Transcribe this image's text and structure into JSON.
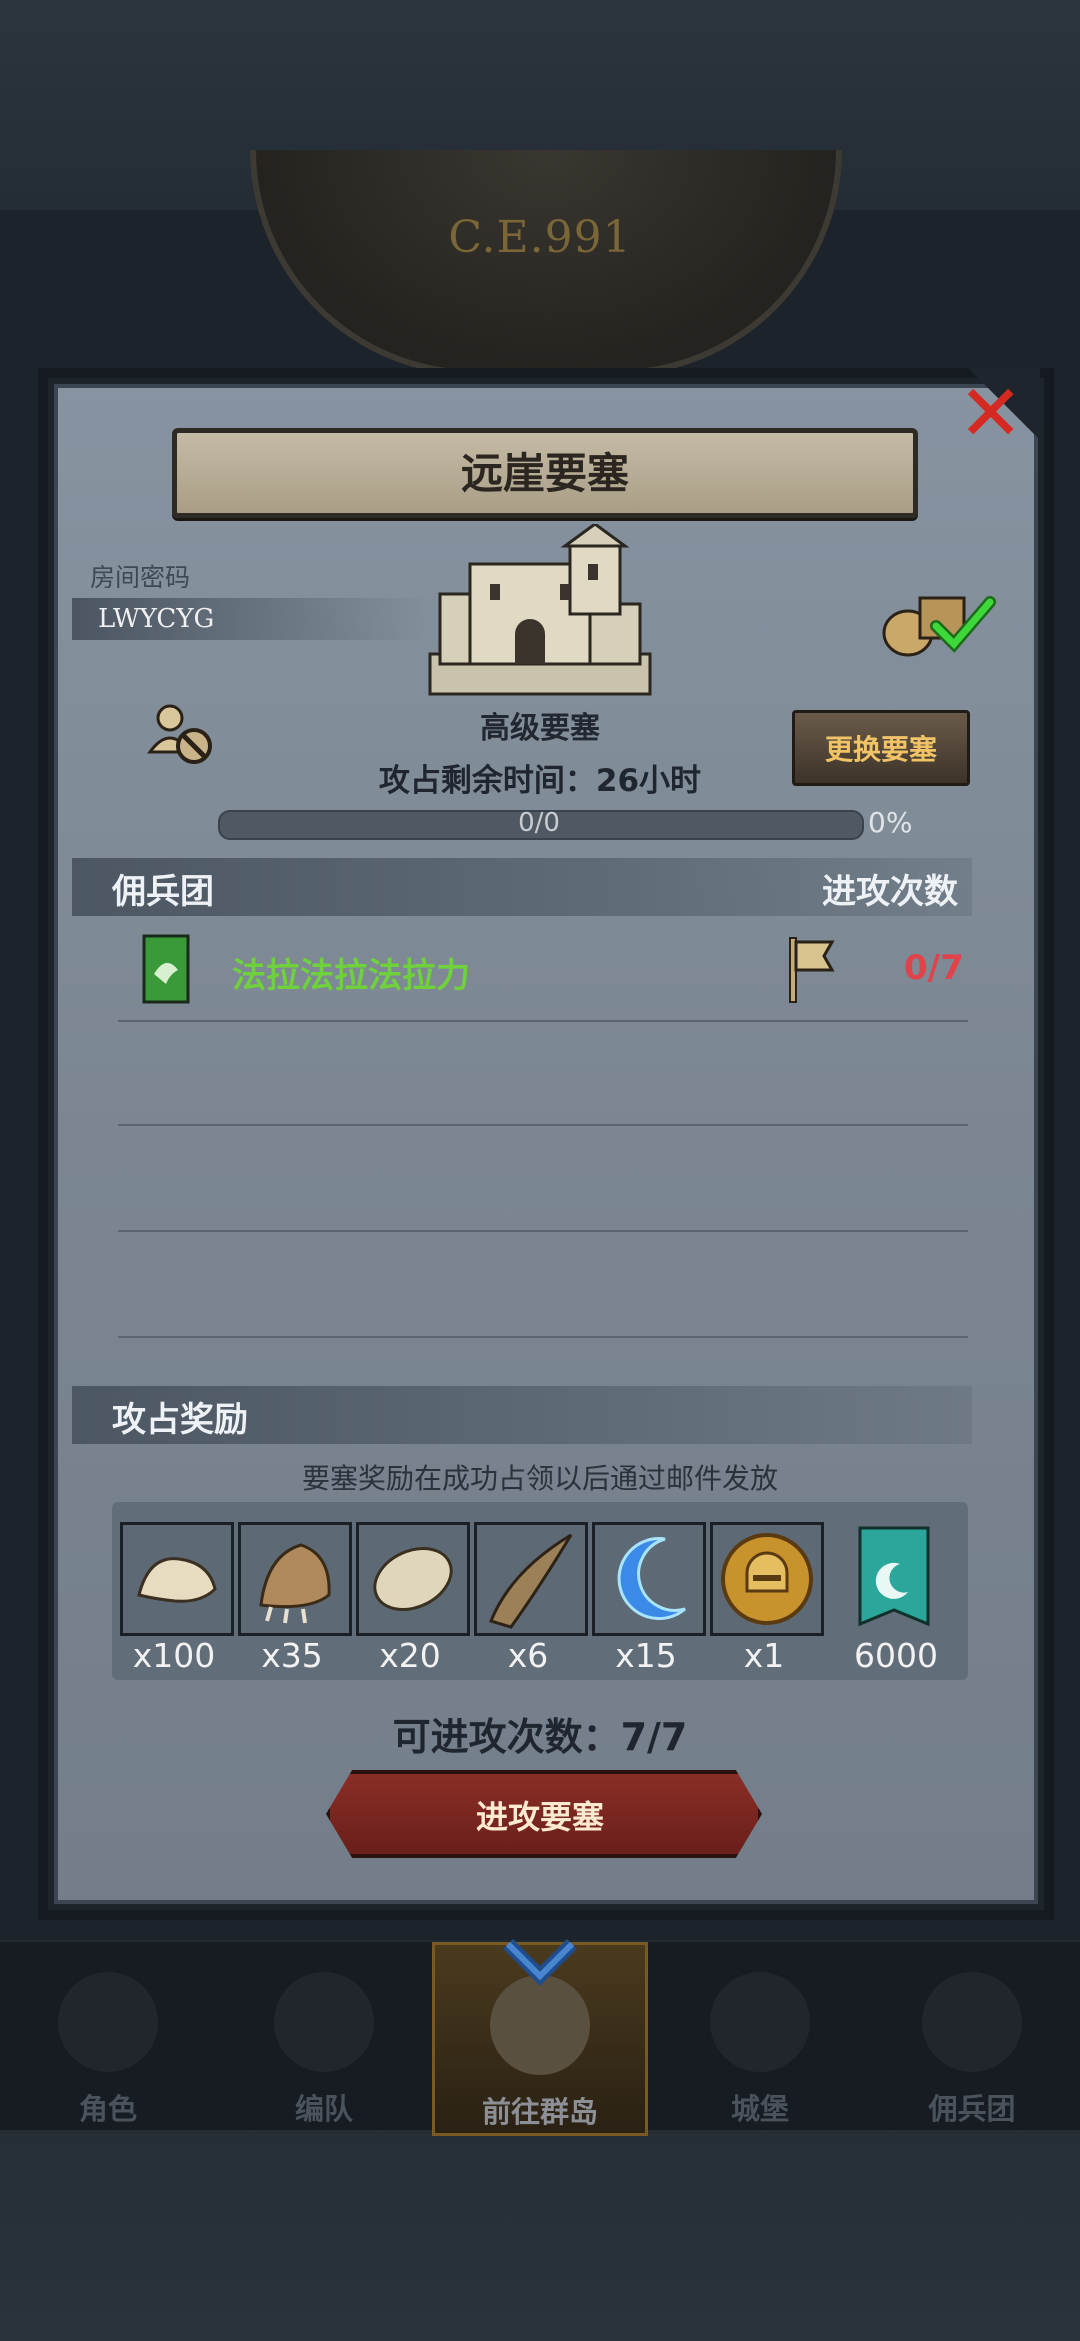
{
  "era": "C.E.991",
  "dialog": {
    "title": "远崖要塞",
    "room_password_label": "房间密码",
    "room_password": "LWYCYG",
    "fortress_level": "高级要塞",
    "time_left": "攻占剩余时间：26小时",
    "change_button": "更换要塞",
    "progress": {
      "text": "0/0",
      "percent_text": "0%",
      "fraction": 0
    },
    "mercenary_section": {
      "title": "佣兵团",
      "attack_count_header": "进攻次数"
    },
    "guild": {
      "name": "法拉法拉法拉力",
      "attacks": "0/7"
    },
    "reward_section": {
      "title": "攻占奖励",
      "note": "要塞奖励在成功占领以后通过邮件发放"
    },
    "rewards": [
      {
        "icon": "fur-pelt-icon",
        "qty": "x100"
      },
      {
        "icon": "beast-claw-icon",
        "qty": "x35"
      },
      {
        "icon": "feather-scale-icon",
        "qty": "x20"
      },
      {
        "icon": "horn-icon",
        "qty": "x6"
      },
      {
        "icon": "blue-crescent-icon",
        "qty": "x15"
      },
      {
        "icon": "golden-helmet-medal-icon",
        "qty": "x1"
      },
      {
        "icon": "guild-banner-icon",
        "qty": "6000"
      }
    ],
    "remaining_attacks": "可进攻次数：7/7",
    "attack_button": "进攻要塞"
  },
  "nav": {
    "items": [
      {
        "label": "角色",
        "icon": "character-icon"
      },
      {
        "label": "编队",
        "icon": "formation-icon"
      },
      {
        "label": "前往群岛",
        "icon": "islands-icon",
        "active": true
      },
      {
        "label": "城堡",
        "icon": "castle-icon"
      },
      {
        "label": "佣兵团",
        "icon": "mercenary-icon"
      }
    ]
  },
  "colors": {
    "guild_name": "#6fd13b",
    "attack_count": "#e0434a",
    "change_button_text": "#f0c466"
  }
}
